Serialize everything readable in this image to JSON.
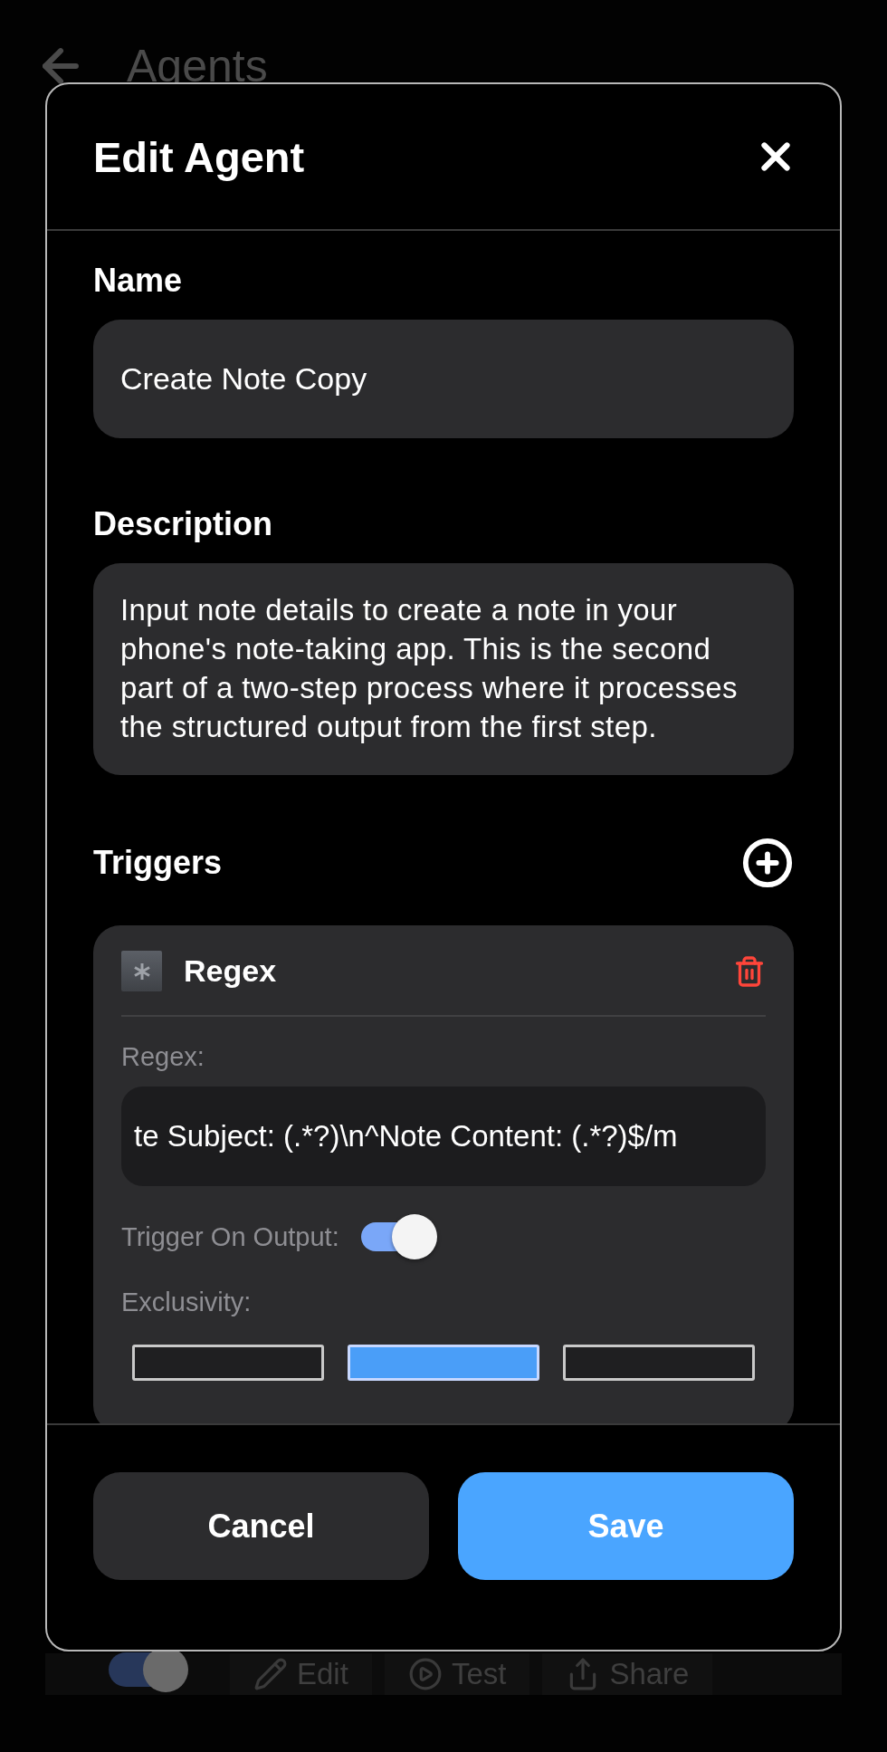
{
  "background": {
    "title": "Agents",
    "toggle_on": true,
    "actions": [
      {
        "label": "Edit",
        "kind": "edit"
      },
      {
        "label": "Test",
        "kind": "test"
      },
      {
        "label": "Share",
        "kind": "share"
      }
    ]
  },
  "dialog": {
    "title": "Edit Agent",
    "name": {
      "label": "Name",
      "value": "Create Note Copy"
    },
    "description": {
      "label": "Description",
      "value": "Input note details to create a note in your phone's note-taking app. This is the second part of a two-step process where it processes the structured output from the first step."
    },
    "triggers": {
      "label": "Triggers",
      "items": [
        {
          "kind": "regex",
          "title": "Regex",
          "field_label": "Regex:",
          "value": "te Subject: (.*?)\\n^Note Content: (.*?)$/m",
          "output_label": "Trigger On Output:",
          "trigger_on_output": true,
          "exclusivity_label": "Exclusivity:",
          "exclusivity_options": [
            {
              "selected": false
            },
            {
              "selected": true
            },
            {
              "selected": false
            }
          ]
        }
      ]
    },
    "buttons": [
      {
        "label": "Cancel",
        "kind": "secondary"
      },
      {
        "label": "Save",
        "kind": "primary"
      }
    ]
  }
}
